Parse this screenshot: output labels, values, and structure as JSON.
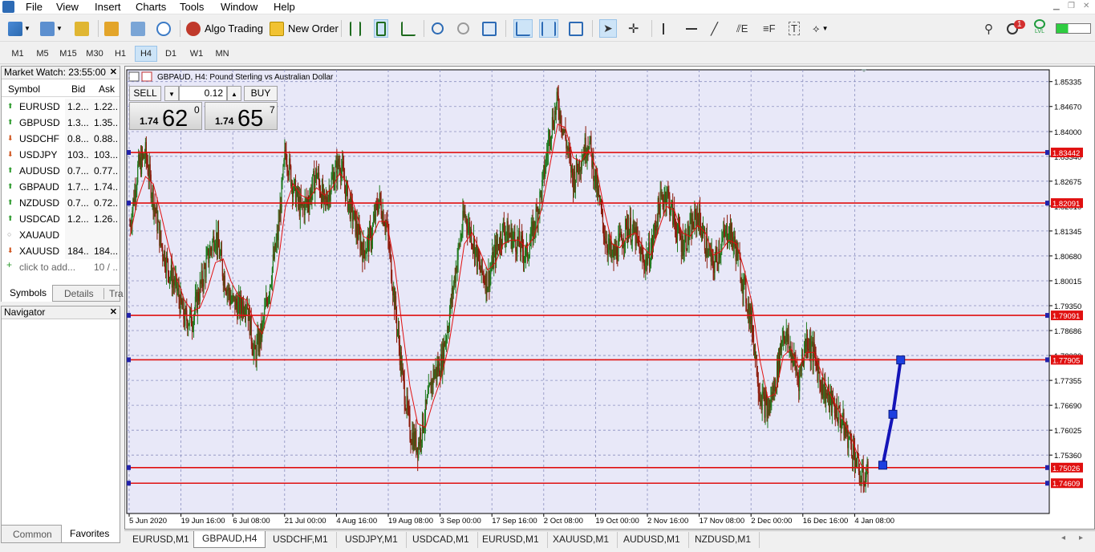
{
  "menu": {
    "items": [
      "File",
      "View",
      "Insert",
      "Charts",
      "Tools",
      "Window",
      "Help"
    ]
  },
  "toolbar": {
    "algo_trading": "Algo Trading",
    "new_order": "New Order",
    "notification_count": "1",
    "signal_label": "LVL"
  },
  "timeframes": {
    "items": [
      "M1",
      "M5",
      "M15",
      "M30",
      "H1",
      "H4",
      "D1",
      "W1",
      "MN"
    ],
    "active": "H4"
  },
  "market_watch": {
    "title": "Market Watch: 23:55:00",
    "columns": [
      "Symbol",
      "Bid",
      "Ask"
    ],
    "rows": [
      {
        "symbol": "EURUSD",
        "bid": "1.2...",
        "ask": "1.22...",
        "dir": "up"
      },
      {
        "symbol": "GBPUSD",
        "bid": "1.3...",
        "ask": "1.35...",
        "dir": "up"
      },
      {
        "symbol": "USDCHF",
        "bid": "0.8...",
        "ask": "0.88...",
        "dir": "down"
      },
      {
        "symbol": "USDJPY",
        "bid": "103....",
        "ask": "103....",
        "dir": "down"
      },
      {
        "symbol": "AUDUSD",
        "bid": "0.7...",
        "ask": "0.77...",
        "dir": "up"
      },
      {
        "symbol": "GBPAUD",
        "bid": "1.7...",
        "ask": "1.74...",
        "dir": "up"
      },
      {
        "symbol": "NZDUSD",
        "bid": "0.7...",
        "ask": "0.72...",
        "dir": "up"
      },
      {
        "symbol": "USDCAD",
        "bid": "1.2...",
        "ask": "1.26...",
        "dir": "up"
      },
      {
        "symbol": "XAUAUD",
        "bid": "",
        "ask": "",
        "dir": "none"
      },
      {
        "symbol": "XAUUSD",
        "bid": "184...",
        "ask": "184...",
        "dir": "down"
      }
    ],
    "add_row": {
      "label": "click to add...",
      "count": "10 / ..."
    },
    "tabs": [
      "Symbols",
      "Details",
      "Tra"
    ]
  },
  "navigator": {
    "title": "Navigator",
    "tabs": [
      "Common",
      "Favorites"
    ]
  },
  "chart": {
    "title": "GBPAUD, H4:  Pound Sterling vs Australian Dollar",
    "one_click": {
      "sell": "SELL",
      "buy": "BUY",
      "lot": "0.12",
      "bid_small": "1.74",
      "bid_big": "62",
      "bid_sup": "0",
      "ask_small": "1.74",
      "ask_big": "65",
      "ask_sup": "7"
    },
    "colors": {
      "grid": "#8a8fbf",
      "bg": "#e8e8f8",
      "candle_up": "#1f7a1f",
      "candle_down": "#8b1a0a",
      "ma": "#e01010",
      "hline": "#e01010",
      "trend": "#1414b8"
    }
  },
  "chart_data": {
    "type": "line",
    "title": "GBPAUD, H4:  Pound Sterling vs Australian Dollar",
    "xlabel": "",
    "ylabel": "",
    "ylim": [
      1.738,
      1.8565
    ],
    "y_ticks": [
      "1.85335",
      "1.84670",
      "1.84000",
      "1.83340",
      "1.82675",
      "1.82010",
      "1.81345",
      "1.80680",
      "1.80015",
      "1.79350",
      "1.78686",
      "1.78020",
      "1.77355",
      "1.76690",
      "1.76025",
      "1.75360"
    ],
    "x_ticks": [
      "5 Jun 2020",
      "19 Jun 16:00",
      "6 Jul 08:00",
      "21 Jul 00:00",
      "4 Aug 16:00",
      "19 Aug 08:00",
      "3 Sep 00:00",
      "17 Sep 16:00",
      "2 Oct 08:00",
      "19 Oct 00:00",
      "2 Nov 16:00",
      "17 Nov 08:00",
      "2 Dec 00:00",
      "16 Dec 16:00",
      "4 Jan 08:00"
    ],
    "horizontal_levels": [
      "1.83442",
      "1.82091",
      "1.79091",
      "1.77905",
      "1.75026",
      "1.74609"
    ],
    "price_path": [
      1.815,
      1.83,
      1.834,
      1.822,
      1.81,
      1.803,
      1.798,
      1.79,
      1.79,
      1.798,
      1.806,
      1.813,
      1.802,
      1.795,
      1.793,
      1.795,
      1.78,
      1.787,
      1.8,
      1.812,
      1.835,
      1.825,
      1.819,
      1.822,
      1.829,
      1.82,
      1.827,
      1.832,
      1.822,
      1.815,
      1.808,
      1.812,
      1.822,
      1.815,
      1.795,
      1.775,
      1.76,
      1.756,
      1.765,
      1.775,
      1.778,
      1.79,
      1.805,
      1.818,
      1.812,
      1.803,
      1.8,
      1.808,
      1.814,
      1.812,
      1.81,
      1.807,
      1.815,
      1.825,
      1.84,
      1.848,
      1.838,
      1.827,
      1.833,
      1.838,
      1.825,
      1.813,
      1.806,
      1.81,
      1.815,
      1.812,
      1.805,
      1.808,
      1.82,
      1.824,
      1.816,
      1.81,
      1.813,
      1.818,
      1.81,
      1.804,
      1.81,
      1.814,
      1.808,
      1.798,
      1.788,
      1.77,
      1.765,
      1.773,
      1.787,
      1.781,
      1.774,
      1.785,
      1.78,
      1.772,
      1.768,
      1.765,
      1.76,
      1.755,
      1.747,
      1.749
    ],
    "ma_path": [
      1.812,
      1.822,
      1.828,
      1.826,
      1.818,
      1.809,
      1.801,
      1.795,
      1.792,
      1.793,
      1.798,
      1.805,
      1.806,
      1.8,
      1.796,
      1.795,
      1.789,
      1.786,
      1.793,
      1.804,
      1.82,
      1.826,
      1.823,
      1.822,
      1.825,
      1.823,
      1.825,
      1.829,
      1.826,
      1.819,
      1.812,
      1.811,
      1.816,
      1.816,
      1.805,
      1.788,
      1.772,
      1.762,
      1.761,
      1.768,
      1.774,
      1.783,
      1.796,
      1.81,
      1.813,
      1.808,
      1.803,
      1.805,
      1.81,
      1.811,
      1.811,
      1.809,
      1.812,
      1.82,
      1.831,
      1.842,
      1.841,
      1.833,
      1.832,
      1.835,
      1.83,
      1.819,
      1.81,
      1.809,
      1.812,
      1.813,
      1.809,
      1.807,
      1.814,
      1.82,
      1.819,
      1.813,
      1.812,
      1.815,
      1.813,
      1.807,
      1.808,
      1.811,
      1.81,
      1.803,
      1.794,
      1.779,
      1.769,
      1.77,
      1.78,
      1.782,
      1.777,
      1.781,
      1.781,
      1.775,
      1.77,
      1.766,
      1.762,
      1.757,
      1.751,
      1.749
    ],
    "trend_points": [
      {
        "bar": 96.8,
        "price": 1.7509
      },
      {
        "bar": 98.1,
        "price": 1.7645
      },
      {
        "bar": 99.1,
        "price": 1.779
      }
    ]
  },
  "bottom_tabs": {
    "items": [
      "EURUSD,M1",
      "GBPAUD,H4",
      "USDCHF,M1",
      "USDJPY,M1",
      "USDCAD,M1",
      "EURUSD,M1",
      "XAUUSD,M1",
      "AUDUSD,M1",
      "NZDUSD,M1"
    ],
    "active": "GBPAUD,H4"
  }
}
